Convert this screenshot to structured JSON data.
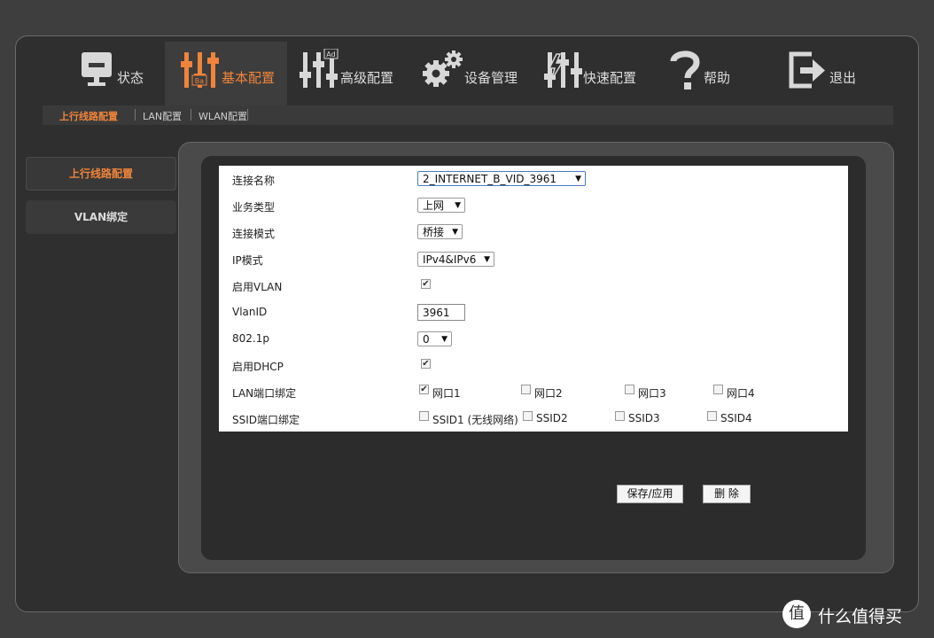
{
  "colors": {
    "accent": "#f0843a",
    "background": "#2f2f2f",
    "panel": "#ffffff"
  },
  "topnav": [
    {
      "label": "状态",
      "icon": "monitor-icon",
      "active": false
    },
    {
      "label": "基本配置",
      "icon": "sliders-basic-icon",
      "active": true
    },
    {
      "label": "高级配置",
      "icon": "sliders-advanced-icon",
      "active": false
    },
    {
      "label": "设备管理",
      "icon": "gears-icon",
      "active": false
    },
    {
      "label": "快速配置",
      "icon": "sliders-lightning-icon",
      "active": false
    },
    {
      "label": "帮助",
      "icon": "question-icon",
      "active": false
    },
    {
      "label": "退出",
      "icon": "logout-icon",
      "active": false
    }
  ],
  "subtabs": [
    {
      "label": "上行线路配置",
      "active": true
    },
    {
      "label": "LAN配置",
      "active": false
    },
    {
      "label": "WLAN配置",
      "active": false
    }
  ],
  "sidebar": [
    {
      "label": "上行线路配置",
      "active": true
    },
    {
      "label": "VLAN绑定",
      "active": false
    }
  ],
  "form": {
    "connection_name": {
      "label": "连接名称",
      "value": "2_INTERNET_B_VID_3961"
    },
    "service_type": {
      "label": "业务类型",
      "value": "上网"
    },
    "connection_mode": {
      "label": "连接模式",
      "value": "桥接"
    },
    "ip_mode": {
      "label": "IP模式",
      "value": "IPv4&IPv6"
    },
    "enable_vlan": {
      "label": "启用VLAN",
      "checked": true
    },
    "vlan_id": {
      "label": "VlanID",
      "value": "3961"
    },
    "p8021": {
      "label": "802.1p",
      "value": "0"
    },
    "enable_dhcp": {
      "label": "启用DHCP",
      "checked": true
    },
    "lan_binding": {
      "label": "LAN端口绑定",
      "ports": [
        {
          "label": "网口1",
          "checked": true
        },
        {
          "label": "网口2",
          "checked": false
        },
        {
          "label": "网口3",
          "checked": false
        },
        {
          "label": "网口4",
          "checked": false
        }
      ]
    },
    "ssid_binding": {
      "label": "SSID端口绑定",
      "ports": [
        {
          "label": "SSID1 (无线网络)",
          "checked": false
        },
        {
          "label": "SSID2",
          "checked": false
        },
        {
          "label": "SSID3",
          "checked": false
        },
        {
          "label": "SSID4",
          "checked": false
        }
      ]
    }
  },
  "buttons": {
    "save": "保存/应用",
    "delete": "删  除"
  },
  "watermark": {
    "icon_glyph": "值",
    "text": "什么值得买"
  }
}
